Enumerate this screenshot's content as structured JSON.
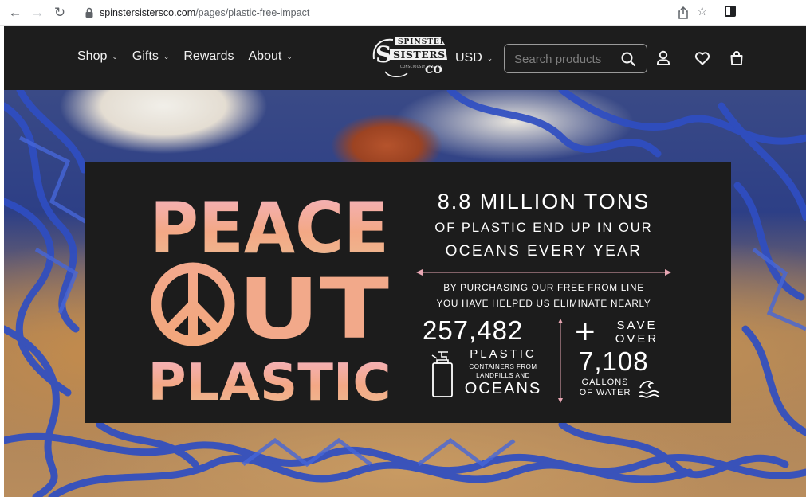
{
  "browser": {
    "url_domain": "spinstersistersco.com",
    "url_path": "/pages/plastic-free-impact"
  },
  "header": {
    "nav": [
      {
        "label": "Shop",
        "has_dropdown": true
      },
      {
        "label": "Gifts",
        "has_dropdown": true
      },
      {
        "label": "Rewards",
        "has_dropdown": false
      },
      {
        "label": "About",
        "has_dropdown": true
      }
    ],
    "logo": {
      "line1": "SPINSTER",
      "line2": "SISTERS",
      "line3": "CO",
      "tagline": "CONSCIOUSLY CRAFTED"
    },
    "currency": "USD",
    "search_placeholder": "Search products"
  },
  "hero": {
    "headline": {
      "word1": "PEACE",
      "word2": "UT",
      "word3": "PLASTIC"
    },
    "stat_title": "8.8 MILLION TONS",
    "stat_line1": "OF PLASTIC END UP IN OUR",
    "stat_line2": "OCEANS EVERY YEAR",
    "sub_line1": "BY PURCHASING OUR FREE FROM LINE",
    "sub_line2": "YOU HAVE HELPED US ELIMINATE NEARLY",
    "containers_count": "257,482",
    "containers_label1": "PLASTIC",
    "containers_label2": "CONTAINERS FROM",
    "containers_label3": "LANDFILLS AND",
    "containers_label4": "OCEANS",
    "plus_sign": "+",
    "save_line1": "SAVE",
    "save_line2": "OVER",
    "gallons_count": "7,108",
    "gallons_line1": "GALLONS",
    "gallons_line2": "OF WATER"
  },
  "colors": {
    "header_bg": "#1d1d1d",
    "panel_bg": "#1c1c1c",
    "headline_pink": "#f4b3c2",
    "headline_peach": "#f3a885",
    "headline_teal": "#7fcfc3",
    "accent_pink": "#e9a7b4"
  },
  "icons": [
    "back-arrow-icon",
    "forward-arrow-icon",
    "reload-icon",
    "lock-icon",
    "share-icon",
    "star-icon",
    "side-panel-icon",
    "search-icon",
    "account-icon",
    "heart-icon",
    "bag-icon",
    "peace-sign-icon",
    "bottle-icon",
    "wave-icon"
  ]
}
